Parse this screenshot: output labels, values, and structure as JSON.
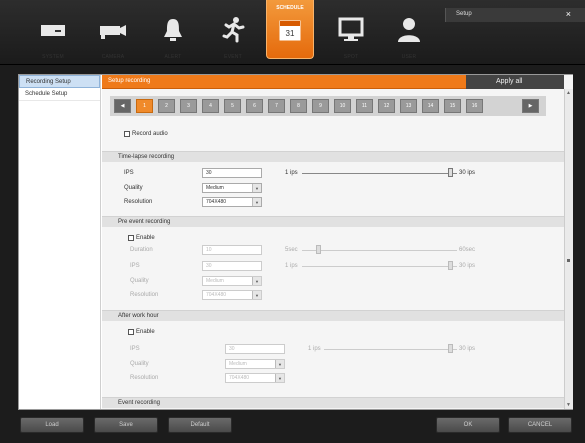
{
  "toolbar": {
    "items": [
      {
        "label": "SYSTEM",
        "icon": "system-icon"
      },
      {
        "label": "CAMERA",
        "icon": "camera-icon"
      },
      {
        "label": "ALERT",
        "icon": "bell-icon"
      },
      {
        "label": "EVENT",
        "icon": "running-man-icon"
      },
      {
        "label": "SCHEDULE",
        "icon": "calendar-icon",
        "day": "31"
      },
      {
        "label": "SPOT",
        "icon": "monitor-icon"
      },
      {
        "label": "USER",
        "icon": "user-icon"
      }
    ],
    "accent": "#ef7a1a"
  },
  "window": {
    "title": "Setup",
    "close": "×"
  },
  "sidebar": {
    "items": [
      {
        "label": "Recording Setup"
      },
      {
        "label": "Schedule Setup"
      }
    ]
  },
  "header": {
    "title": "Setup recording",
    "apply_all": "Apply all"
  },
  "channels": [
    "1",
    "2",
    "3",
    "4",
    "5",
    "6",
    "7",
    "8",
    "9",
    "10",
    "11",
    "12",
    "13",
    "14",
    "15",
    "16"
  ],
  "record_audio": "Record audio",
  "timelapse": {
    "title": "Time-lapse recording",
    "ips_label": "IPS",
    "ips_value": "30",
    "quality_label": "Quality",
    "quality_value": "Medium",
    "resolution_label": "Resolution",
    "resolution_value": "704X480",
    "slider_min": "1 ips",
    "slider_max": "30 ips"
  },
  "pre_event": {
    "title": "Pre event recording",
    "enable": "Enable",
    "duration_label": "Duration",
    "duration_value": "10",
    "ips_label": "IPS",
    "ips_value": "30",
    "quality_label": "Quality",
    "quality_value": "Medium",
    "resolution_label": "Resolution",
    "resolution_value": "704X480",
    "dur_min": "5sec",
    "dur_max": "60sec",
    "ips_min": "1 ips",
    "ips_max": "30 ips"
  },
  "after_work": {
    "title": "After work hour",
    "enable": "Enable",
    "ips_label": "IPS",
    "ips_value": "30",
    "quality_label": "Quality",
    "quality_value": "Medium",
    "resolution_label": "Resolution",
    "resolution_value": "704X480",
    "ips_min": "1 ips",
    "ips_max": "30 ips"
  },
  "event_recording": {
    "title": "Event recording"
  },
  "buttons": {
    "load": "Load",
    "save": "Save",
    "default": "Default",
    "ok": "OK",
    "cancel": "CANCEL"
  }
}
